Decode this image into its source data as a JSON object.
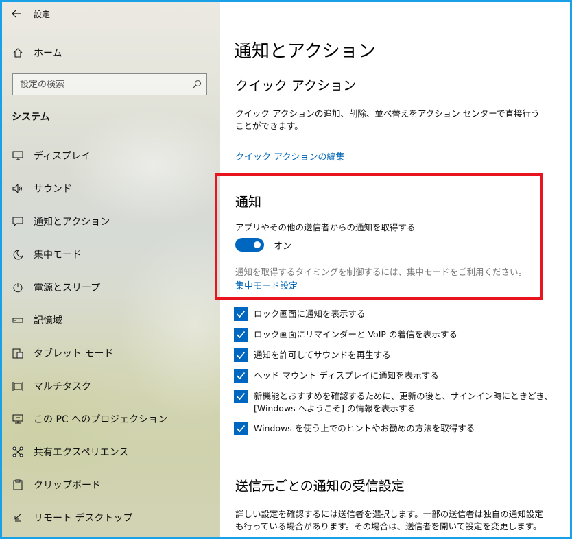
{
  "titlebar": {
    "title": "設定"
  },
  "sidebar": {
    "home_label": "ホーム",
    "search_placeholder": "設定の検索",
    "section_header": "システム",
    "items": [
      {
        "label": "ディスプレイ",
        "icon": "monitor-icon"
      },
      {
        "label": "サウンド",
        "icon": "speaker-icon"
      },
      {
        "label": "通知とアクション",
        "icon": "notification-icon"
      },
      {
        "label": "集中モード",
        "icon": "moon-icon"
      },
      {
        "label": "電源とスリープ",
        "icon": "power-icon"
      },
      {
        "label": "記憶域",
        "icon": "storage-icon"
      },
      {
        "label": "タブレット モード",
        "icon": "tablet-icon"
      },
      {
        "label": "マルチタスク",
        "icon": "multitask-icon"
      },
      {
        "label": "この PC へのプロジェクション",
        "icon": "projection-icon"
      },
      {
        "label": "共有エクスペリエンス",
        "icon": "share-icon"
      },
      {
        "label": "クリップボード",
        "icon": "clipboard-icon"
      },
      {
        "label": "リモート デスクトップ",
        "icon": "remote-desktop-icon"
      }
    ]
  },
  "main": {
    "page_title": "通知とアクション",
    "quick_actions": {
      "heading": "クイック アクション",
      "description": "クイック アクションの追加、削除、並べ替えをアクション センターで直接行うことができます。",
      "edit_link": "クイック アクションの編集"
    },
    "notifications": {
      "heading": "通知",
      "toggle_caption": "アプリやその他の送信者からの通知を取得する",
      "toggle_state": "オン",
      "focus_hint": "通知を取得するタイミングを制御するには、集中モードをご利用ください。",
      "focus_link": "集中モード設定"
    },
    "checkboxes": [
      {
        "label": "ロック画面に通知を表示する",
        "checked": true
      },
      {
        "label": "ロック画面にリマインダーと VoIP の着信を表示する",
        "checked": true
      },
      {
        "label": "通知を許可してサウンドを再生する",
        "checked": true
      },
      {
        "label": "ヘッド マウント ディスプレイに通知を表示する",
        "checked": true
      },
      {
        "label": "新機能とおすすめを確認するために、更新の後と、サインイン時にときどき、[Windows へようこそ] の情報を表示する",
        "checked": true
      },
      {
        "label": "Windows を使う上でのヒントやお勧めの方法を取得する",
        "checked": true
      }
    ],
    "per_sender": {
      "heading": "送信元ごとの通知の受信設定",
      "description": "詳しい設定を確認するには送信者を選択します。一部の送信者は独自の通知設定も行っている場合があります。その場合は、送信者を開いて設定を変更します。"
    }
  },
  "colors": {
    "accent": "#0067c0",
    "link": "#0067b8",
    "highlight_border": "#e8141e",
    "window_border": "#1aa0e6"
  }
}
